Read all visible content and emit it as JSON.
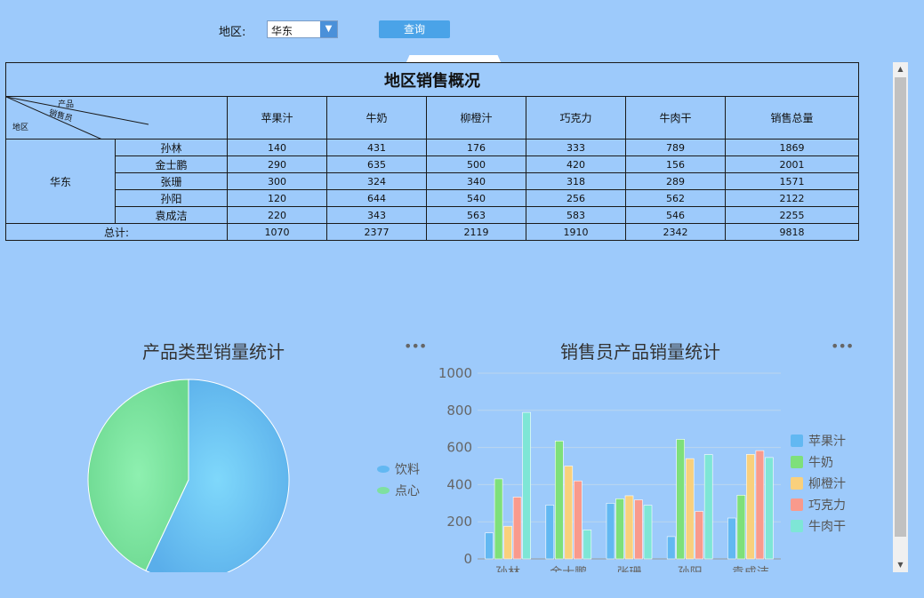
{
  "query": {
    "region_label": "地区:",
    "region_value": "华东",
    "search_label": "查询"
  },
  "report": {
    "title": "地区销售概况",
    "corner": {
      "product": "产品",
      "salesperson": "销售员",
      "region": "地区"
    },
    "columns": [
      "苹果汁",
      "牛奶",
      "柳橙汁",
      "巧克力",
      "牛肉干",
      "销售总量"
    ],
    "region": "华东",
    "rows": [
      {
        "name": "孙林",
        "values": [
          "140",
          "431",
          "176",
          "333",
          "789",
          "1869"
        ]
      },
      {
        "name": "金士鹏",
        "values": [
          "290",
          "635",
          "500",
          "420",
          "156",
          "2001"
        ]
      },
      {
        "name": "张珊",
        "values": [
          "300",
          "324",
          "340",
          "318",
          "289",
          "1571"
        ]
      },
      {
        "name": "孙阳",
        "values": [
          "120",
          "644",
          "540",
          "256",
          "562",
          "2122"
        ]
      },
      {
        "name": "袁成洁",
        "values": [
          "220",
          "343",
          "563",
          "583",
          "546",
          "2255"
        ]
      }
    ],
    "total_label": "总计:",
    "totals": [
      "1070",
      "2377",
      "2119",
      "1910",
      "2342",
      "9818"
    ]
  },
  "chart_data": [
    {
      "type": "pie",
      "title": "产品类型销量统计",
      "labels": [
        "饮料",
        "点心"
      ],
      "values": [
        57,
        43
      ],
      "colors": [
        "#62b8f2",
        "#7ee0a0"
      ]
    },
    {
      "type": "bar",
      "title": "销售员产品销量统计",
      "categories": [
        "孙林",
        "金士鹏",
        "张珊",
        "孙阳",
        "袁成洁"
      ],
      "series": [
        {
          "name": "苹果汁",
          "values": [
            140,
            290,
            300,
            120,
            220
          ],
          "color": "#62b8f2"
        },
        {
          "name": "牛奶",
          "values": [
            431,
            635,
            324,
            644,
            343
          ],
          "color": "#7ee07a"
        },
        {
          "name": "柳橙汁",
          "values": [
            176,
            500,
            340,
            540,
            563
          ],
          "color": "#f9d07c"
        },
        {
          "name": "巧克力",
          "values": [
            333,
            420,
            318,
            256,
            583
          ],
          "color": "#f99a8c"
        },
        {
          "name": "牛肉干",
          "values": [
            789,
            156,
            289,
            562,
            546
          ],
          "color": "#7ee6d6"
        }
      ],
      "ylim": [
        0,
        1000
      ],
      "yticks": [
        "0",
        "200",
        "400",
        "600",
        "800",
        "1000"
      ],
      "grid": true,
      "legend": "right"
    }
  ],
  "icons": {
    "more": "more-icon",
    "dropdown": "chevron-down-icon"
  }
}
